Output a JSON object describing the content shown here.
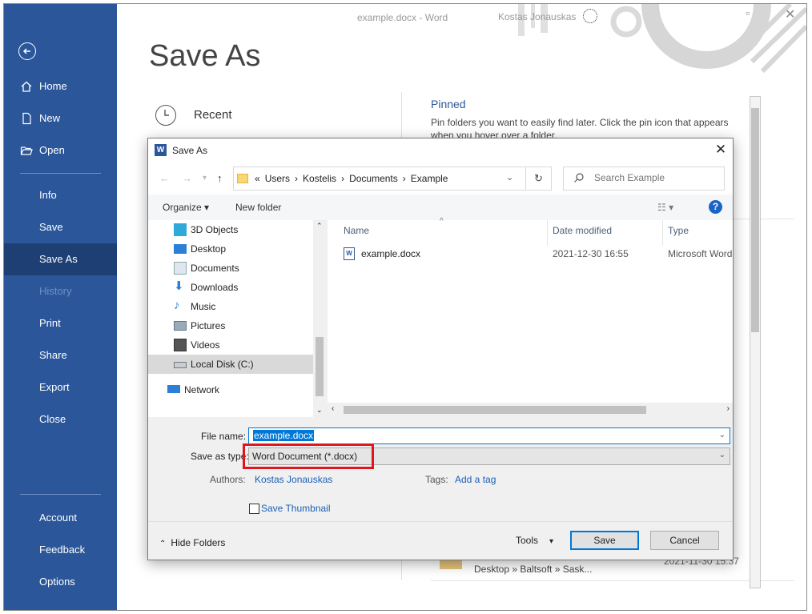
{
  "window": {
    "title": "example.docx - Word",
    "user": "Kostas Jonauskas"
  },
  "sidebar": {
    "items": [
      {
        "label": "Home"
      },
      {
        "label": "New"
      },
      {
        "label": "Open"
      },
      {
        "label": "Info"
      },
      {
        "label": "Save"
      },
      {
        "label": "Save As"
      },
      {
        "label": "History"
      },
      {
        "label": "Print"
      },
      {
        "label": "Share"
      },
      {
        "label": "Export"
      },
      {
        "label": "Close"
      },
      {
        "label": "Account"
      },
      {
        "label": "Feedback"
      },
      {
        "label": "Options"
      }
    ]
  },
  "backstage": {
    "heading": "Save As",
    "recent": "Recent",
    "pinned_title": "Pinned",
    "pinned_desc": "Pin folders you want to easily find later. Click the pin icon that appears when you hover over a folder.",
    "bottom_path": "Desktop » Baltsoft » Sask...",
    "bottom_date": "2021-11-30 15:37"
  },
  "dialog": {
    "title": "Save As",
    "breadcrumb": [
      "«",
      "Users",
      "›",
      "Kostelis",
      "›",
      "Documents",
      "›",
      "Example"
    ],
    "search_placeholder": "Search Example",
    "organize": "Organize ▾",
    "new_folder": "New folder",
    "tree": [
      {
        "label": "3D Objects",
        "icon": "3d-objects-icon"
      },
      {
        "label": "Desktop",
        "icon": "desktop-icon"
      },
      {
        "label": "Documents",
        "icon": "documents-icon"
      },
      {
        "label": "Downloads",
        "icon": "downloads-icon"
      },
      {
        "label": "Music",
        "icon": "music-icon"
      },
      {
        "label": "Pictures",
        "icon": "pictures-icon"
      },
      {
        "label": "Videos",
        "icon": "videos-icon"
      },
      {
        "label": "Local Disk (C:)",
        "icon": "disk-icon"
      },
      {
        "label": "Network",
        "icon": "network-icon"
      }
    ],
    "columns": {
      "name": "Name",
      "date": "Date modified",
      "type": "Type"
    },
    "files": [
      {
        "name": "example.docx",
        "date": "2021-12-30 16:55",
        "type": "Microsoft Word"
      }
    ],
    "file_name_label": "File name:",
    "file_name": "example.docx",
    "save_type_label": "Save as type:",
    "save_type": "Word Document (*.docx)",
    "authors_label": "Authors:",
    "authors": "Kostas Jonauskas",
    "tags_label": "Tags:",
    "tags": "Add a tag",
    "thumbnail": "Save Thumbnail",
    "hide_folders": "Hide Folders",
    "tools": "Tools",
    "save": "Save",
    "cancel": "Cancel"
  },
  "colors": {
    "word_blue": "#2b579a",
    "highlight": "#e0151d",
    "accent": "#0078d7"
  }
}
